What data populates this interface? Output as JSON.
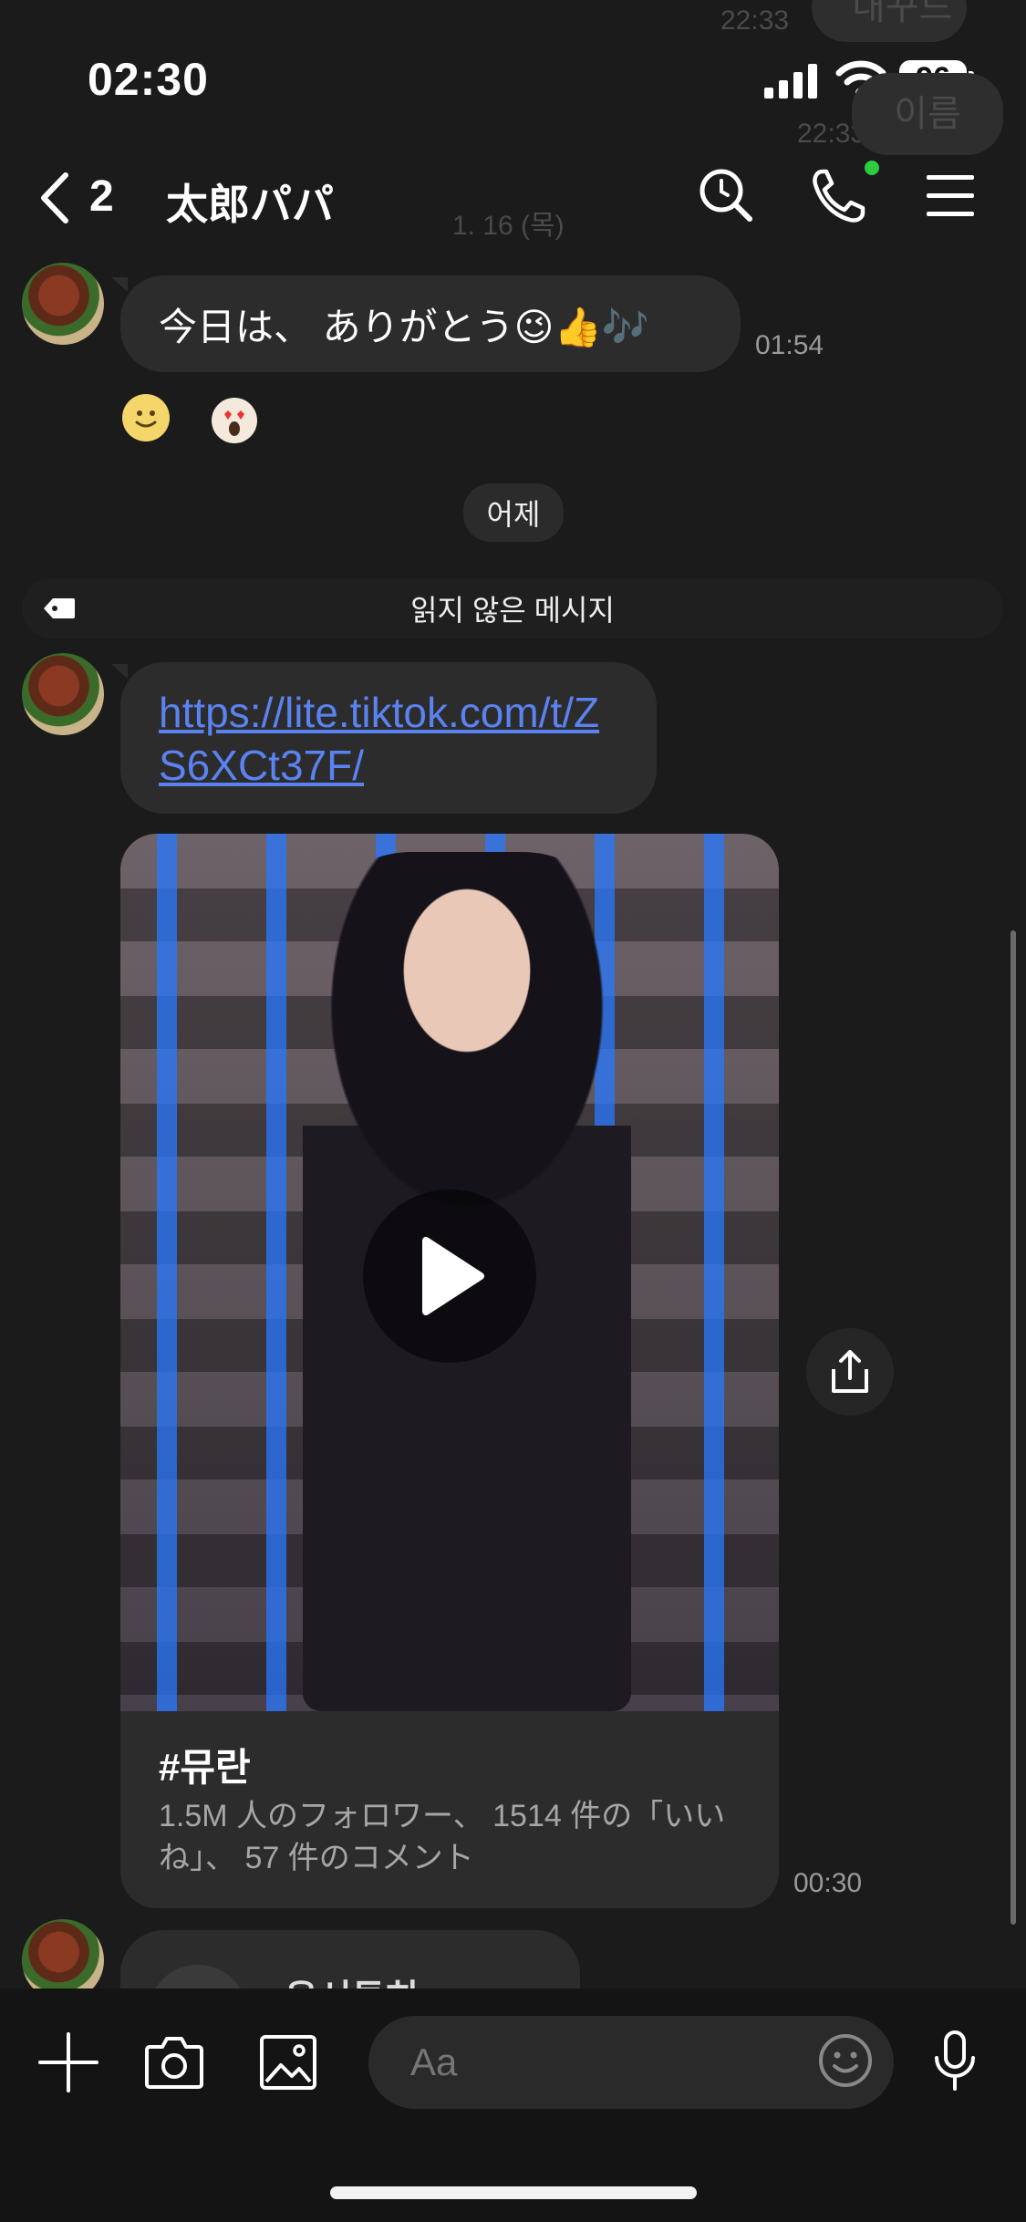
{
  "status_bar": {
    "time": "02:30",
    "battery": "96"
  },
  "ghost": {
    "time_a": "22:33",
    "bubble_a": "내꾸드",
    "time_b": "22:33",
    "bubble_b": "이름",
    "date": "1. 16 (목)"
  },
  "header": {
    "unread_count": "2",
    "title": "太郎パパ"
  },
  "messages": {
    "m1": {
      "text": "今日は、 ありがとう😉👍🎶",
      "time": "01:54"
    },
    "date_separator": "어제",
    "unread_divider": "읽지 않은 메시지",
    "m2": {
      "link": "https://lite.tiktok.com/t/ZS6XCt37F/"
    },
    "card": {
      "title": "#뮤란",
      "description": "1.5M 人のフォロワー、 1514 件の「いいね」、 57 件のコメント",
      "time": "00:30"
    },
    "partial_name": "윤서튜히"
  },
  "input": {
    "placeholder": "Aa"
  },
  "colors": {
    "link": "#5a82f0",
    "bubble": "#2c2c2c",
    "background": "#1b1b1b",
    "online_dot": "#2ecc40"
  },
  "icons": [
    "back-chevron-icon",
    "search-icon",
    "phone-icon",
    "menu-icon",
    "tag-icon",
    "play-icon",
    "share-icon",
    "plus-icon",
    "camera-icon",
    "image-icon",
    "emoji-icon",
    "microphone-icon"
  ]
}
